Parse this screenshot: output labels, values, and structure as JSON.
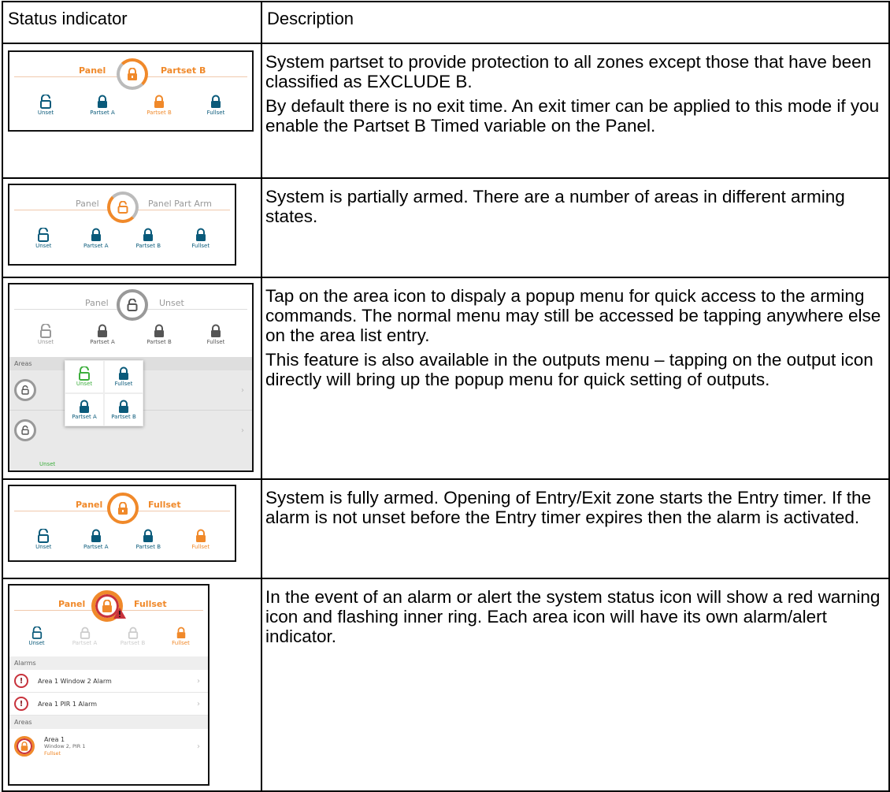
{
  "table": {
    "col_status": "Status indicator",
    "col_description": "Description"
  },
  "rows": [
    {
      "screen": {
        "left": "Panel",
        "right": "Partset B",
        "modes": [
          "Unset",
          "Partset A",
          "Partset B",
          "Fullset"
        ]
      },
      "description": [
        "System partset to provide protection to all zones except those that have been classified as EXCLUDE B.",
        "By default there is no exit time. An exit timer can be applied to this mode if you enable the Partset B Timed variable on the Panel."
      ]
    },
    {
      "screen": {
        "left": "Panel",
        "right": "Panel Part Arm",
        "modes": [
          "Unset",
          "Partset A",
          "Partset B",
          "Fullset"
        ]
      },
      "description": [
        "System is partially armed. There are a number of areas in different arming states."
      ]
    },
    {
      "screen": {
        "left": "Panel",
        "right": "Unset",
        "modes": [
          "Unset",
          "Partset A",
          "Partset B",
          "Fullset"
        ],
        "areas_label": "Areas",
        "popup": [
          "Unset",
          "Fullset",
          "Partset A",
          "Partset B"
        ],
        "list_status": "Unset"
      },
      "description": [
        "Tap on the area icon to dispaly a popup menu for quick access to the arming commands. The normal menu may still be accessed be tapping anywhere else on the area list entry.",
        "This feature is also available in the outputs menu – tapping on the output icon directly will bring up the popup menu for quick setting of outputs."
      ]
    },
    {
      "screen": {
        "left": "Panel",
        "right": "Fullset",
        "modes": [
          "Unset",
          "Partset A",
          "Partset B",
          "Fullset"
        ]
      },
      "description": [
        "System is fully armed. Opening of Entry/Exit zone starts the Entry timer. If the alarm is not unset before the Entry timer expires then the alarm is activated."
      ]
    },
    {
      "screen": {
        "left": "Panel",
        "right": "Fullset",
        "modes": [
          "Unset",
          "Partset A",
          "Partset B",
          "Fullset"
        ],
        "alarms_label": "Alarms",
        "alarms": [
          "Area 1 Window 2 Alarm",
          "Area 1 PIR 1 Alarm"
        ],
        "areas_label": "Areas",
        "area_name": "Area 1",
        "area_detail": "Window 2, PIR 1",
        "area_status": "Fullset"
      },
      "description": [
        "In the event of an alarm or alert the system status icon will show a red warning icon and flashing inner ring. Each area icon will have its own alarm/alert indicator."
      ]
    }
  ],
  "colors": {
    "orange": "#f0892a",
    "blue": "#0a5a7a",
    "grey": "#999999",
    "green": "#3dae3d",
    "alarm_red": "#c8323c"
  },
  "icons": [
    "lock-icon",
    "open-lock-icon",
    "alarm-icon",
    "warning-icon",
    "chevron-right-icon"
  ]
}
